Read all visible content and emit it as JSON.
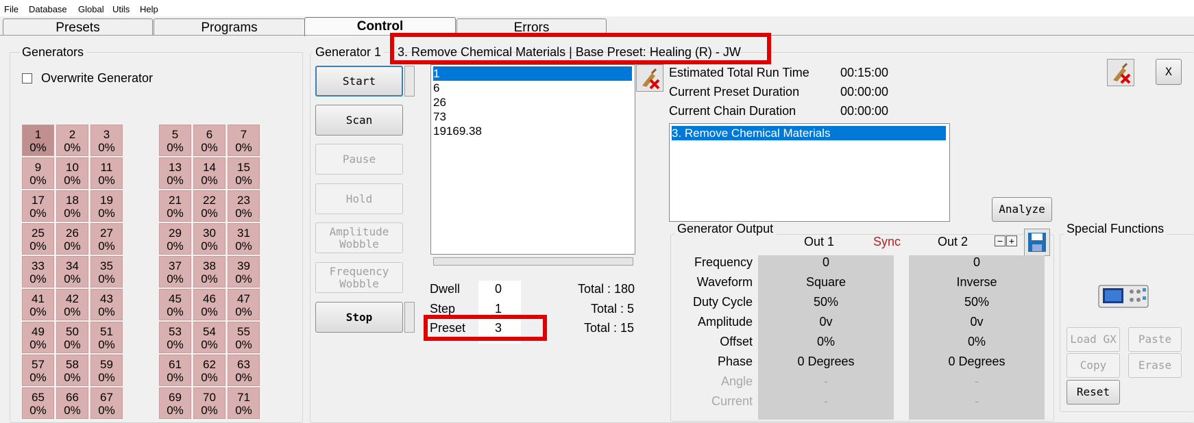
{
  "menu": [
    "File",
    "Database",
    "Global",
    "Utils",
    "Help"
  ],
  "tabs": [
    "Presets",
    "Programs",
    "Control",
    "Errors"
  ],
  "generators_group": {
    "title": "Generators",
    "overwrite_label": "Overwrite Generator",
    "left_cells": [
      {
        "n": "1",
        "p": "0%"
      },
      {
        "n": "2",
        "p": "0%"
      },
      {
        "n": "3",
        "p": "0%"
      },
      {
        "n": "9",
        "p": "0%"
      },
      {
        "n": "10",
        "p": "0%"
      },
      {
        "n": "11",
        "p": "0%"
      },
      {
        "n": "17",
        "p": "0%"
      },
      {
        "n": "18",
        "p": "0%"
      },
      {
        "n": "19",
        "p": "0%"
      },
      {
        "n": "25",
        "p": "0%"
      },
      {
        "n": "26",
        "p": "0%"
      },
      {
        "n": "27",
        "p": "0%"
      },
      {
        "n": "33",
        "p": "0%"
      },
      {
        "n": "34",
        "p": "0%"
      },
      {
        "n": "35",
        "p": "0%"
      },
      {
        "n": "41",
        "p": "0%"
      },
      {
        "n": "42",
        "p": "0%"
      },
      {
        "n": "43",
        "p": "0%"
      },
      {
        "n": "49",
        "p": "0%"
      },
      {
        "n": "50",
        "p": "0%"
      },
      {
        "n": "51",
        "p": "0%"
      },
      {
        "n": "57",
        "p": "0%"
      },
      {
        "n": "58",
        "p": "0%"
      },
      {
        "n": "59",
        "p": "0%"
      },
      {
        "n": "65",
        "p": "0%"
      },
      {
        "n": "66",
        "p": "0%"
      },
      {
        "n": "67",
        "p": "0%"
      }
    ],
    "right_cells": [
      {
        "n": "5",
        "p": "0%"
      },
      {
        "n": "6",
        "p": "0%"
      },
      {
        "n": "7",
        "p": "0%"
      },
      {
        "n": "13",
        "p": "0%"
      },
      {
        "n": "14",
        "p": "0%"
      },
      {
        "n": "15",
        "p": "0%"
      },
      {
        "n": "21",
        "p": "0%"
      },
      {
        "n": "22",
        "p": "0%"
      },
      {
        "n": "23",
        "p": "0%"
      },
      {
        "n": "29",
        "p": "0%"
      },
      {
        "n": "30",
        "p": "0%"
      },
      {
        "n": "31",
        "p": "0%"
      },
      {
        "n": "37",
        "p": "0%"
      },
      {
        "n": "38",
        "p": "0%"
      },
      {
        "n": "39",
        "p": "0%"
      },
      {
        "n": "45",
        "p": "0%"
      },
      {
        "n": "46",
        "p": "0%"
      },
      {
        "n": "47",
        "p": "0%"
      },
      {
        "n": "53",
        "p": "0%"
      },
      {
        "n": "54",
        "p": "0%"
      },
      {
        "n": "55",
        "p": "0%"
      },
      {
        "n": "61",
        "p": "0%"
      },
      {
        "n": "62",
        "p": "0%"
      },
      {
        "n": "63",
        "p": "0%"
      },
      {
        "n": "69",
        "p": "0%"
      },
      {
        "n": "70",
        "p": "0%"
      },
      {
        "n": "71",
        "p": "0%"
      }
    ]
  },
  "control": {
    "generator_label": "Generator 1",
    "header_text": "3. Remove Chemical Materials    | Base Preset: Healing (R) - JW",
    "buttons": {
      "start": "Start",
      "scan": "Scan",
      "pause": "Pause",
      "hold": "Hold",
      "amplitude_wobble": "Amplitude Wobble",
      "frequency_wobble": "Frequency Wobble",
      "stop": "Stop"
    },
    "freq_list": [
      "1",
      "6",
      "26",
      "73",
      "19169.38"
    ],
    "dwell": {
      "label": "Dwell",
      "value": "0",
      "total": "Total : 180"
    },
    "step": {
      "label": "Step",
      "value": "1",
      "total": "Total : 5"
    },
    "preset": {
      "label": "Preset",
      "value": "3",
      "total": "Total : 15"
    }
  },
  "run_info": {
    "estimated_label": "Estimated Total Run Time",
    "estimated_value": "00:15:00",
    "preset_duration_label": "Current Preset Duration",
    "preset_duration_value": "00:00:00",
    "chain_duration_label": "Current Chain Duration",
    "chain_duration_value": "00:00:00",
    "chain_list": [
      "3. Remove Chemical Materials"
    ],
    "analyze_button": "Analyze",
    "close_button": "X"
  },
  "generator_output": {
    "title": "Generator Output",
    "out1": "Out 1",
    "sync": "Sync",
    "out2": "Out 2",
    "rows": [
      {
        "label": "Frequency",
        "out1": "0",
        "out2": "0",
        "disabled": false
      },
      {
        "label": "Waveform",
        "out1": "Square",
        "out2": "Inverse",
        "disabled": false
      },
      {
        "label": "Duty Cycle",
        "out1": "50%",
        "out2": "50%",
        "disabled": false
      },
      {
        "label": "Amplitude",
        "out1": "0v",
        "out2": "0v",
        "disabled": false
      },
      {
        "label": "Offset",
        "out1": "0%",
        "out2": "0%",
        "disabled": false
      },
      {
        "label": "Phase",
        "out1": "0 Degrees",
        "out2": "0 Degrees",
        "disabled": false
      },
      {
        "label": "Angle",
        "out1": "-",
        "out2": "-",
        "disabled": true
      },
      {
        "label": "Current",
        "out1": "-",
        "out2": "-",
        "disabled": true
      }
    ]
  },
  "special_functions": {
    "title": "Special Functions",
    "load_gx": "Load GX",
    "paste": "Paste",
    "copy": "Copy",
    "erase": "Erase",
    "reset": "Reset"
  },
  "colors": {
    "selection": "#0078d7",
    "highlight_box": "#e00000",
    "sync_text": "#b22222",
    "cell": "#d9b0b0"
  }
}
